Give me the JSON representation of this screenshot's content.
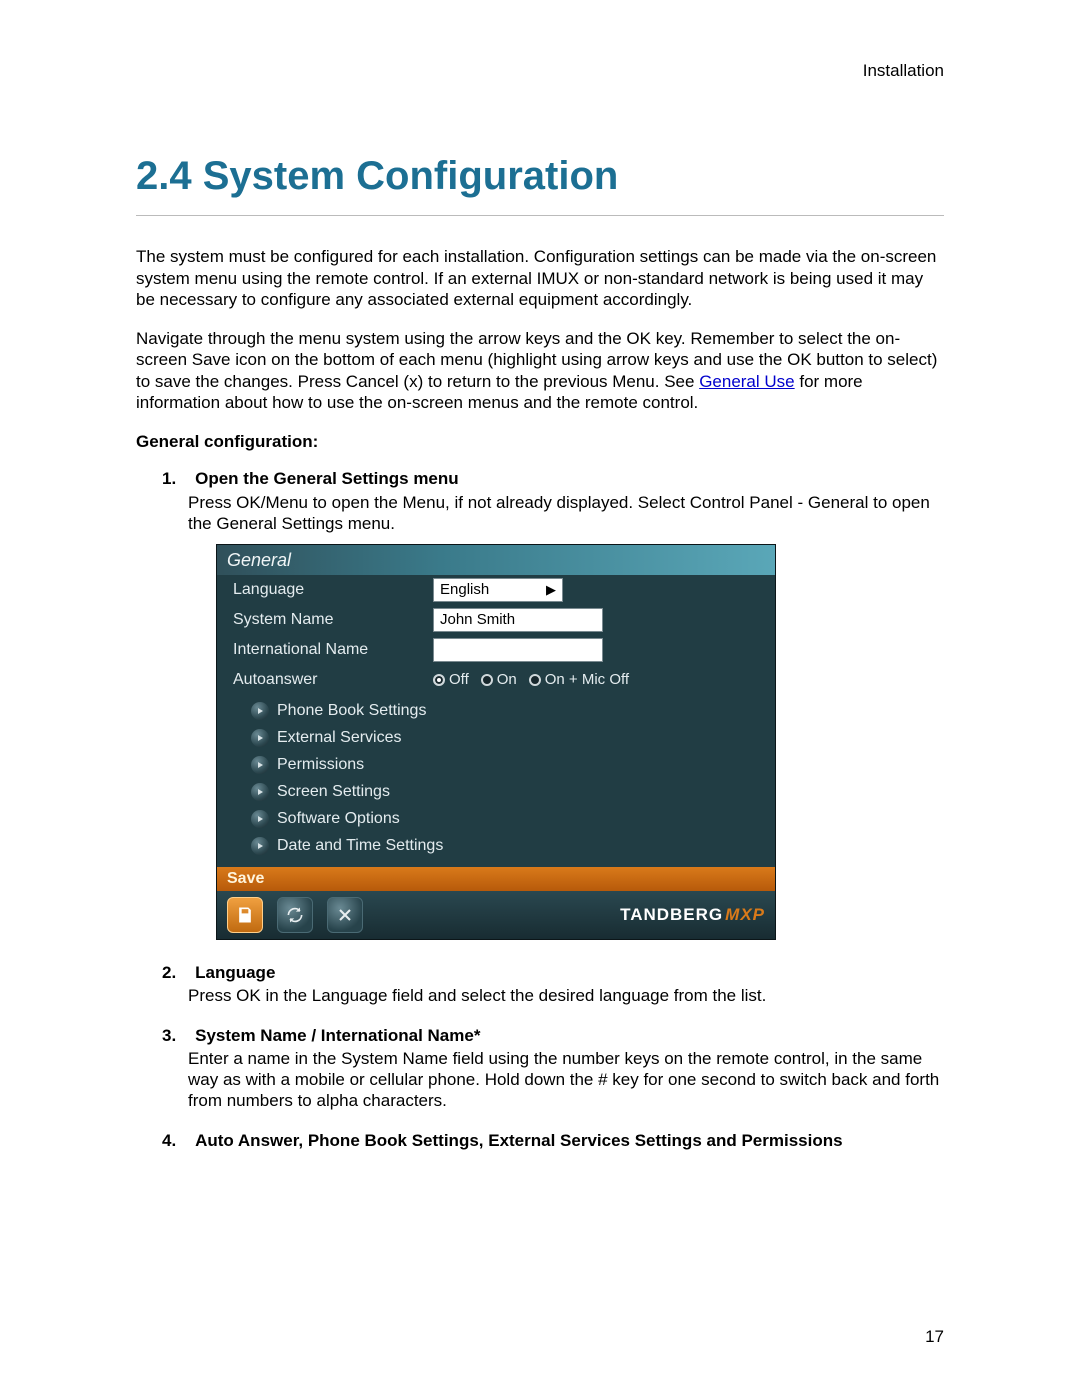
{
  "running_head": "Installation",
  "section_title": "2.4 System Configuration",
  "para1": "The system must be configured for each installation. Configuration settings can be made via the on-screen system menu using the remote control. If an external IMUX or non-standard network is being used it may be necessary to configure any associated external equipment accordingly.",
  "para2a": "Navigate through the menu system using the arrow keys and the OK key. Remember to select the on-screen Save icon on the bottom of each menu (highlight using arrow keys and use the OK button to select) to save the changes. Press Cancel (x) to return to the previous Menu. See ",
  "para2_link": "General Use",
  "para2b": " for more information about how to use the on-screen menus and the remote control.",
  "subhead": "General configuration:",
  "steps": {
    "s1_num": "1.",
    "s1_title": "Open the General Settings menu",
    "s1_body": "Press OK/Menu to open the Menu, if not already displayed. Select Control Panel - General to open the General Settings menu.",
    "s2_num": "2.",
    "s2_title": "Language",
    "s2_body": "Press OK in the Language field and select the desired language from the list.",
    "s3_num": "3.",
    "s3_title": "System Name / International Name*",
    "s3_body": "Enter a name in the System Name field using the number keys on the remote control, in the same way as with a mobile or cellular phone. Hold down the # key for one second to switch back and forth from numbers to alpha characters.",
    "s4_num": "4.",
    "s4_title": "Auto Answer, Phone Book Settings, External Services Settings and Permissions"
  },
  "ui": {
    "header": "General",
    "rows": {
      "language_label": "Language",
      "language_value": "English",
      "sysname_label": "System Name",
      "sysname_value": "John Smith",
      "intlname_label": "International Name",
      "intlname_value": "",
      "autoans_label": "Autoanswer",
      "autoans_opt_off": "Off",
      "autoans_opt_on": "On",
      "autoans_opt_onmic": "On + Mic Off"
    },
    "subitems": [
      "Phone Book Settings",
      "External Services",
      "Permissions",
      "Screen Settings",
      "Software Options",
      "Date and Time Settings"
    ],
    "save_label": "Save",
    "brand_main": "TANDBERG",
    "brand_sub": "MXP"
  },
  "page_number": "17"
}
